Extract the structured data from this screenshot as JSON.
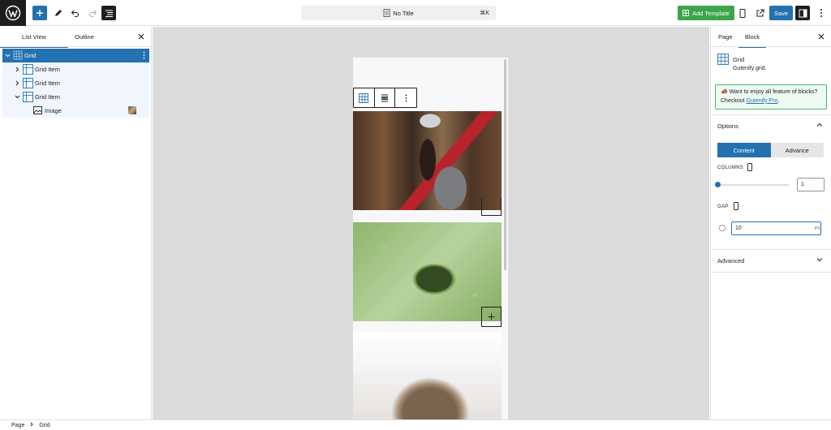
{
  "header": {
    "document_title": "No Title",
    "shortcut": "⌘K",
    "add_template_label": "Add Template",
    "save_label": "Save"
  },
  "left_panel": {
    "tabs": [
      "List View",
      "Outline"
    ],
    "tree": [
      {
        "label": "Grid",
        "selected": true,
        "level": 0
      },
      {
        "label": "Grid Item",
        "level": 1
      },
      {
        "label": "Grid Item",
        "level": 1
      },
      {
        "label": "Grid Item",
        "level": 1,
        "expanded": true
      },
      {
        "label": "Image",
        "level": 2
      }
    ]
  },
  "right_panel": {
    "tabs": [
      "Page",
      "Block"
    ],
    "block_title": "Grid",
    "block_description": "Gutenify grid.",
    "promo_text": "Want to enjoy all feature of blocks? Checkout",
    "promo_link": "Gutenify Pro",
    "promo_end": ".",
    "options_title": "Options",
    "segment": [
      "Content",
      "Advance"
    ],
    "columns_label": "COLUMNS",
    "columns_value": "1",
    "gap_label": "GAP",
    "gap_value": "10",
    "gap_unit": "PX",
    "advanced_title": "Advanced"
  },
  "breadcrumb": [
    "Page",
    "Grid"
  ],
  "colors": {
    "accent": "#2271b1",
    "template_green": "#3da44a",
    "promo_border": "#45bb6a"
  }
}
